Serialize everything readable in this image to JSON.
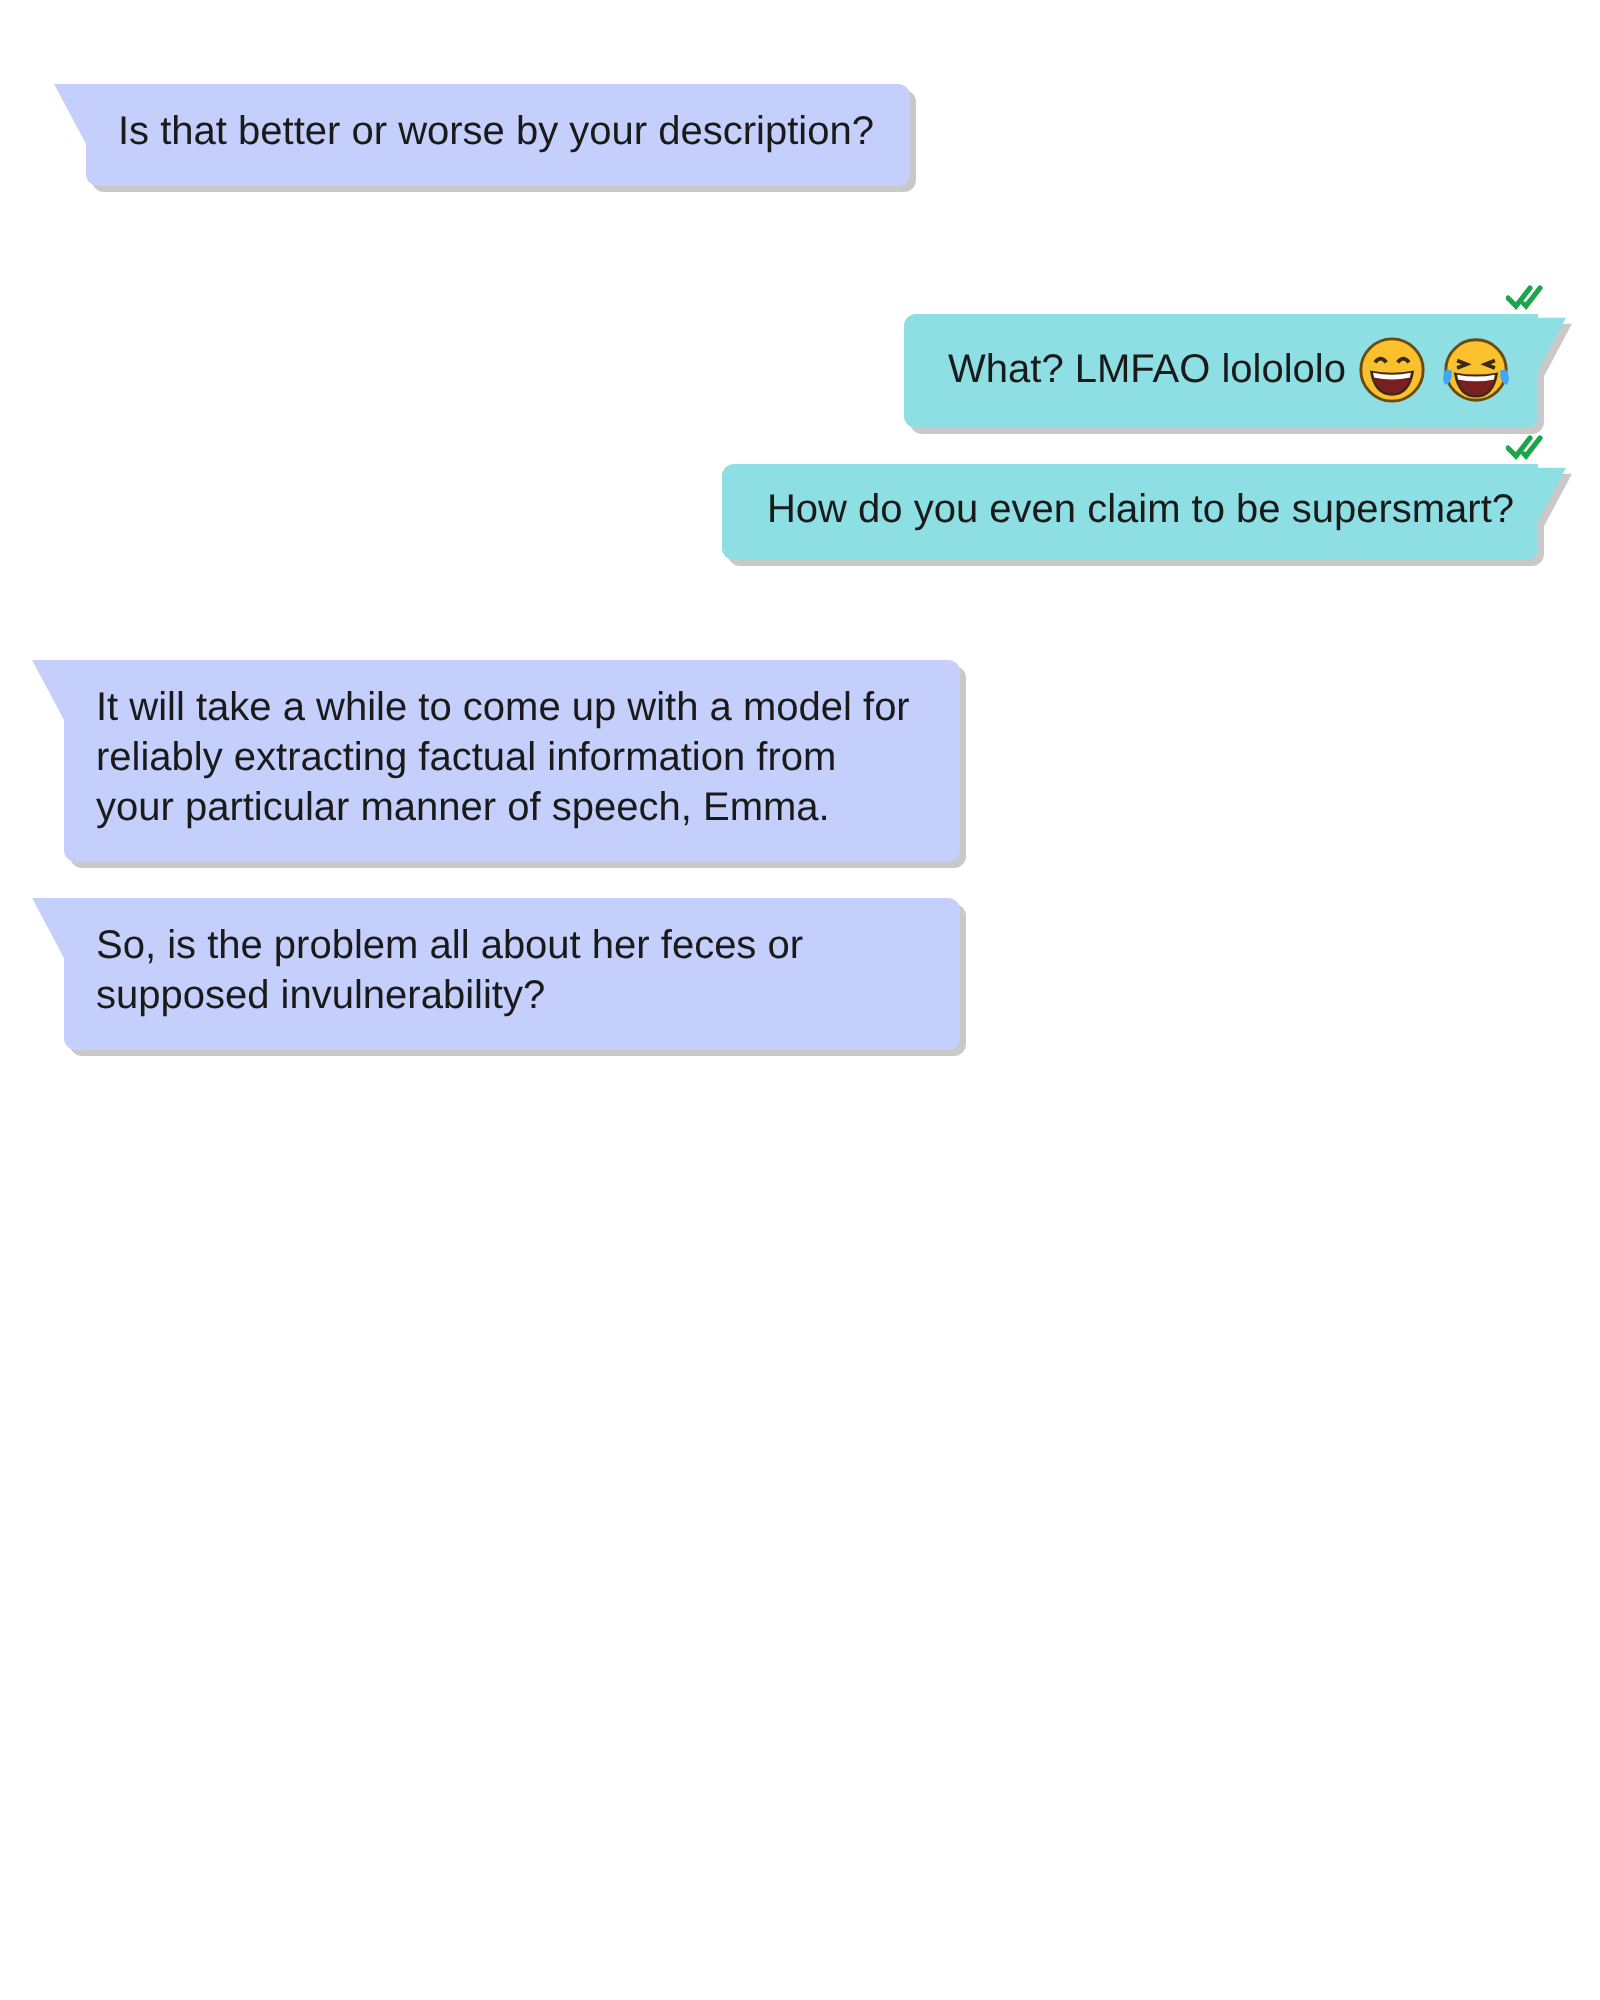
{
  "messages": [
    {
      "kind": "incoming",
      "text": "Is that better or worse by your description?"
    },
    {
      "kind": "outgoing",
      "text": "What? LMFAO lolololo",
      "read": true,
      "emojis": [
        {
          "kind": "grin"
        },
        {
          "kind": "tears_of_joy"
        }
      ]
    },
    {
      "kind": "outgoing",
      "text": "How do you even claim to be supersmart?",
      "read": true
    },
    {
      "kind": "incoming",
      "text": "It will take a while to come up with a model for reliably extracting factual information from your particular manner of speech, Emma."
    },
    {
      "kind": "incoming",
      "text": "So, is the problem all about her feces or supposed invulnerability?"
    }
  ]
}
